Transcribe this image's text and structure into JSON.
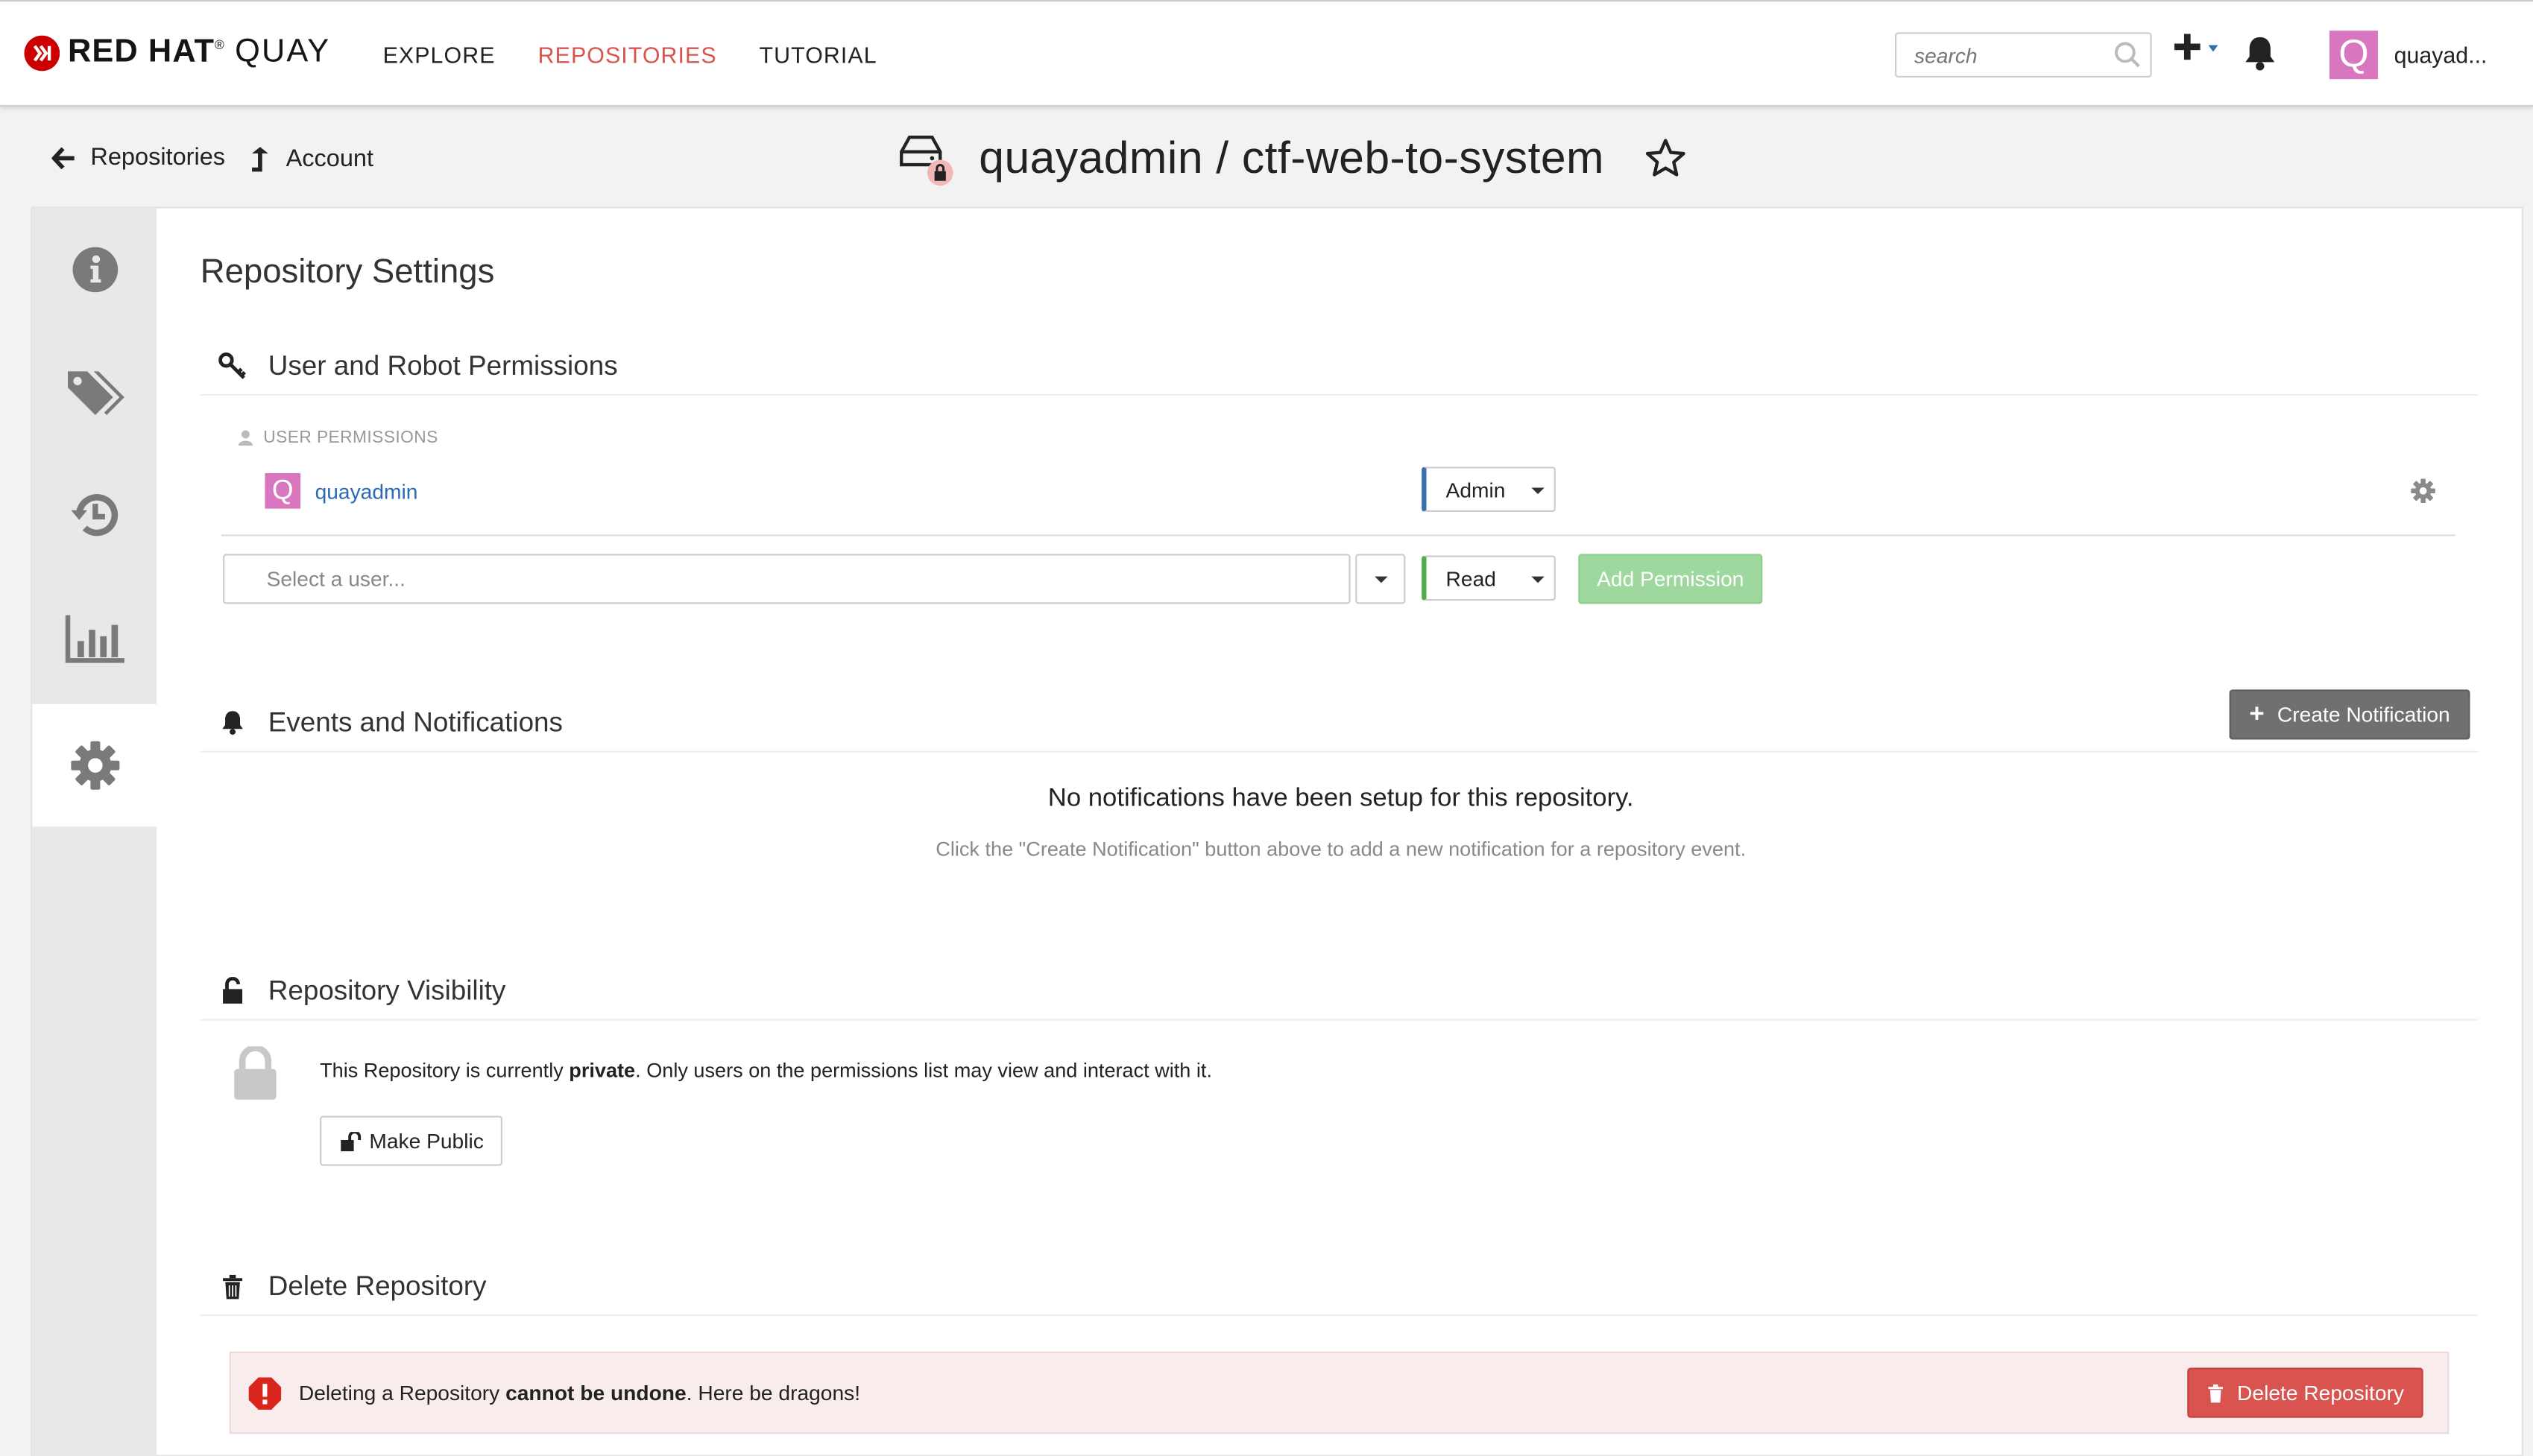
{
  "brand": {
    "mark": "Ⓚ",
    "red": "RED",
    "hat": "HAT",
    "registered": "®",
    "product": "QUAY",
    "color": "#cc0000"
  },
  "nav": {
    "explore": "EXPLORE",
    "repositories": "REPOSITORIES",
    "tutorial": "TUTORIAL",
    "active_color": "#d9534f"
  },
  "search": {
    "placeholder": "search"
  },
  "user": {
    "avatar_letter": "Q",
    "name": "quayad...",
    "avatar_color": "#d877c0"
  },
  "breadcrumbs": {
    "back": "Repositories",
    "up": "Account"
  },
  "repo": {
    "title": "quayadmin / ctf-web-to-system",
    "private": true
  },
  "sidebar": {
    "tabs": [
      {
        "id": "info",
        "icon": "info-icon"
      },
      {
        "id": "tags",
        "icon": "tags-icon"
      },
      {
        "id": "history",
        "icon": "history-icon"
      },
      {
        "id": "usage",
        "icon": "bar-chart-icon"
      },
      {
        "id": "settings",
        "icon": "gear-icon",
        "active": true
      }
    ]
  },
  "settings": {
    "title": "Repository Settings",
    "permissions": {
      "title": "User and Robot Permissions",
      "user_section_label": "USER PERMISSIONS",
      "rows": [
        {
          "avatar_letter": "Q",
          "name": "quayadmin",
          "role": "Admin"
        }
      ],
      "new_user_placeholder": "Select a user...",
      "new_role": "Read",
      "add_button": "Add Permission"
    },
    "notifications": {
      "title": "Events and Notifications",
      "create_button": "Create Notification",
      "empty_title": "No notifications have been setup for this repository.",
      "empty_sub": "Click the \"Create Notification\" button above to add a new notification for a repository event."
    },
    "visibility": {
      "title": "Repository Visibility",
      "text_pre": "This Repository is currently ",
      "text_bold": "private",
      "text_post": ". Only users on the permissions list may view and interact with it.",
      "button": "Make Public"
    },
    "delete": {
      "title": "Delete Repository",
      "text_pre": "Deleting a Repository ",
      "text_bold": "cannot be undone",
      "text_post": ". Here be dragons!",
      "button": "Delete Repository",
      "danger_color": "#d9534f"
    }
  }
}
